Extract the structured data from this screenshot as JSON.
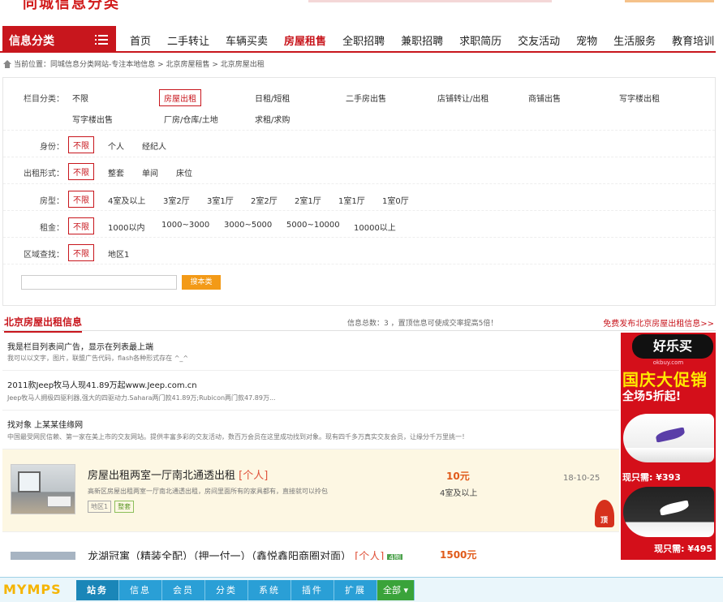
{
  "header": {
    "site_logo_fragment": "同城信息分类",
    "category_button": "信息分类"
  },
  "nav": {
    "items": [
      "首页",
      "二手转让",
      "车辆买卖",
      "房屋租售",
      "全职招聘",
      "兼职招聘",
      "求职简历",
      "交友活动",
      "宠物",
      "生活服务",
      "教育培训"
    ],
    "active_index": 3
  },
  "breadcrumb": "当前位置：同城信息分类网站-专注本地信息 > 北京房屋租售 > 北京房屋出租",
  "filters": {
    "category": {
      "label": "栏目分类：",
      "options": [
        "不限",
        "房屋出租",
        "日租/短租",
        "二手房出售",
        "店铺转让/出租",
        "商铺出售",
        "写字楼出租",
        "写字楼出售",
        "厂房/仓库/土地",
        "求租/求购"
      ],
      "selected": "房屋出租"
    },
    "identity": {
      "label": "身份：",
      "options": [
        "不限",
        "个人",
        "经纪人"
      ],
      "selected": "不限"
    },
    "rent_type": {
      "label": "出租形式：",
      "options": [
        "不限",
        "整套",
        "单间",
        "床位"
      ],
      "selected": "不限"
    },
    "room": {
      "label": "房型：",
      "options": [
        "不限",
        "4室及以上",
        "3室2厅",
        "3室1厅",
        "2室2厅",
        "2室1厅",
        "1室1厅",
        "1室0厅"
      ],
      "selected": "不限"
    },
    "rent": {
      "label": "租金：",
      "options": [
        "不限",
        "1000以内",
        "1000~3000",
        "3000~5000",
        "5000~10000",
        "10000以上"
      ],
      "selected": "不限"
    },
    "area": {
      "label": "区域查找：",
      "options": [
        "不限",
        "地区1"
      ],
      "selected": "不限"
    },
    "search_button": "搜本类"
  },
  "listing": {
    "title": "北京房屋出租信息",
    "total_text": "信息总数：3 ，置顶信息可使成交率提高5倍！",
    "post_link": "免费发布北京房屋出租信息>>",
    "ads": [
      {
        "title": "我是栏目列表间广告，显示在列表最上端",
        "desc": "我可以以文字，图片，联盟广告代码，flash各种形式存在 ^_^"
      },
      {
        "title": "2011款Jeep牧马人现41.89万起www.Jeep.com.cn",
        "desc": "Jeep牧马人拥极四驱利器,强大的四驱动力.Sahara两门款41.89万;Rubicon两门款47.89万..."
      },
      {
        "title": "找对象 上某某佳缘网",
        "desc": "中国最受网民信赖、第一家在美上市的交友网站。提供丰富多彩的交友活动，数百万会员在这里成功找到对象。现有四千多万真实交友会员，让缘分千万里挑一！"
      }
    ],
    "featured": {
      "title": "房屋出租两室一厅南北通透出租",
      "tag": "[个人]",
      "desc": "高新区房屋出租两室一厅南北通透出租，房间里面所有的家具都有，直接就可以拎包",
      "badges": [
        "地区1",
        "整套"
      ],
      "price": "10元",
      "room": "4室及以上",
      "date": "18-10-25",
      "top_label": "顶"
    },
    "second": {
      "title": "龙湖冠寓（精装全配）（押一付一）（鑫悦鑫阳商圈对面）",
      "tag": "[个人]",
      "image_badge": "4图",
      "price": "1500元"
    }
  },
  "side_ad": {
    "brand": "好乐买",
    "domain": "okbuy.com",
    "headline": "国庆大促销",
    "subline": "全场5折起!",
    "price1": "现只需: ¥393",
    "price2": "现只需: ¥495"
  },
  "toolbar": {
    "logo": "MYMPS",
    "tabs": [
      "站务",
      "信息",
      "会员",
      "分类",
      "系统",
      "插件",
      "扩展"
    ],
    "all_label": "全部"
  }
}
